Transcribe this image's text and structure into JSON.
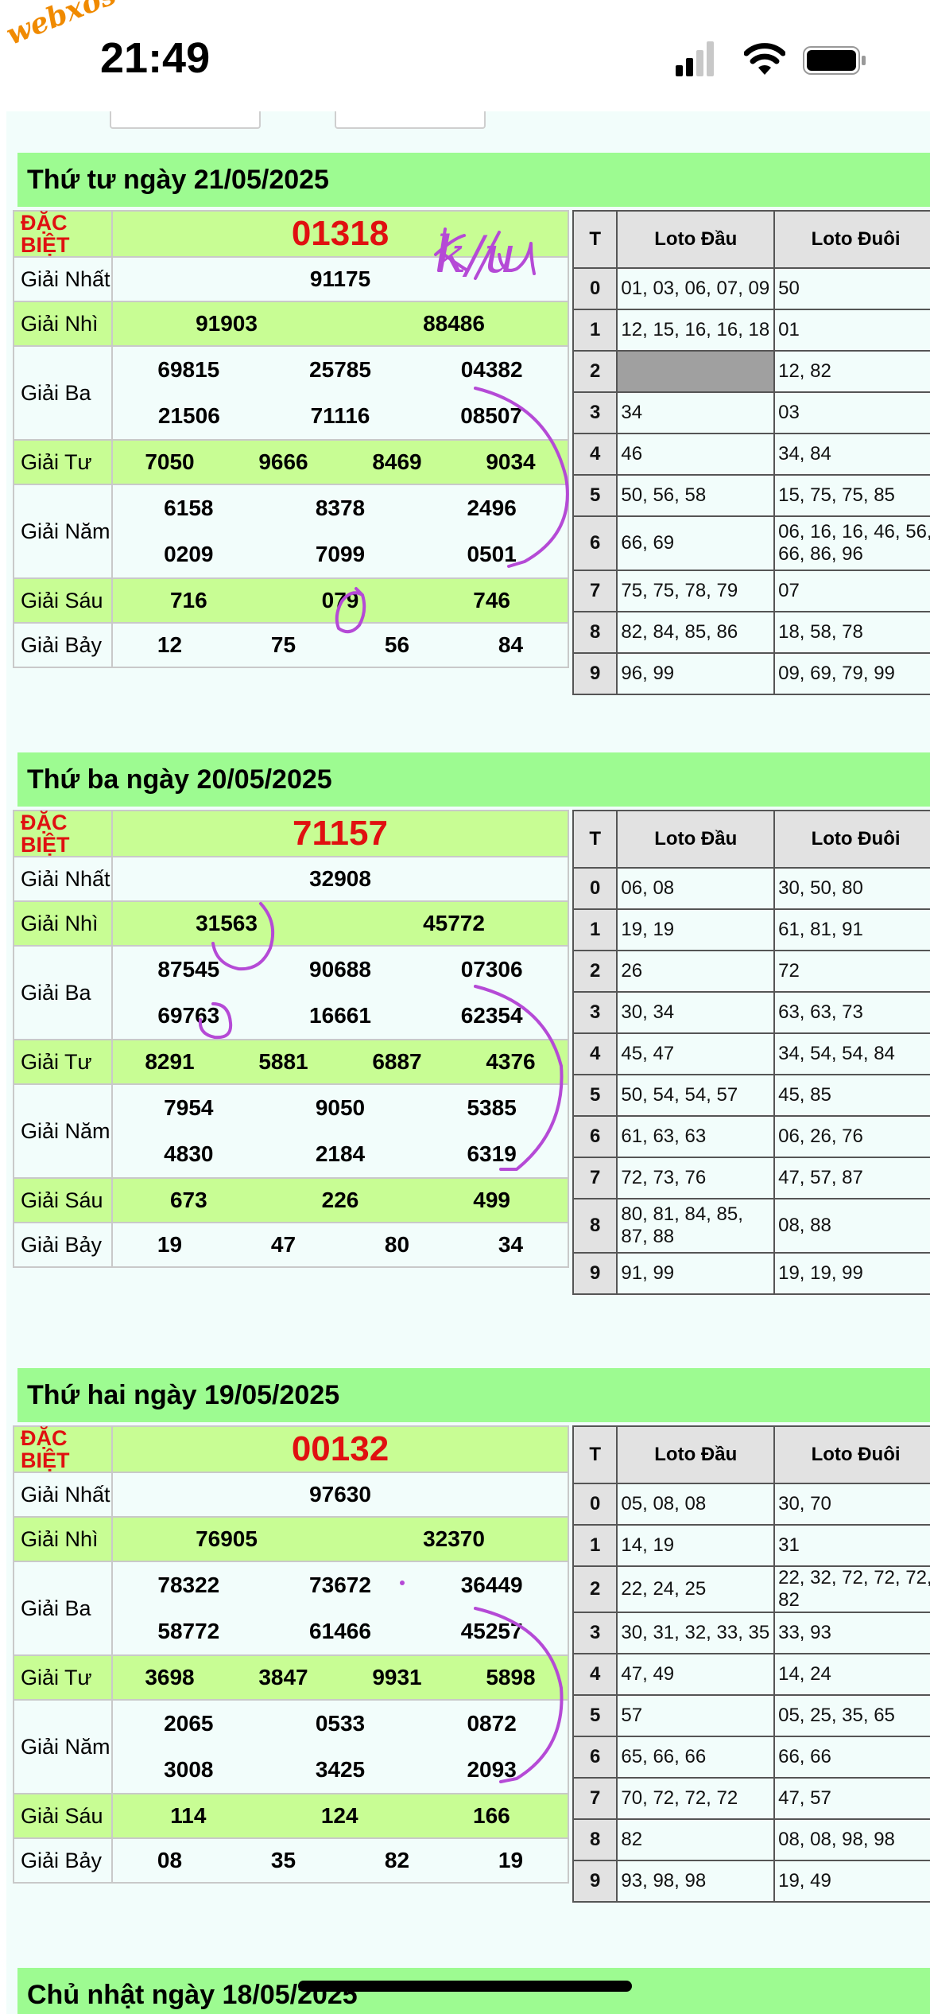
{
  "status": {
    "time": "21:49",
    "watermark": "webxoso.net"
  },
  "labels": {
    "db": "ĐẶC BIỆT",
    "nhat": "Giải Nhất",
    "nhi": "Giải Nhì",
    "ba": "Giải Ba",
    "tu": "Giải Tư",
    "nam": "Giải Năm",
    "sau": "Giải Sáu",
    "bay": "Giải Bảy",
    "t": "T",
    "dau": "Loto Đầu",
    "duoi": "Loto Đuôi"
  },
  "annotation": "k/u",
  "sections": [
    {
      "title": "Thứ tư ngày 21/05/2025",
      "db": "01318",
      "nhat": "91175",
      "nhi": [
        "91903",
        "88486"
      ],
      "ba": [
        [
          "69815",
          "25785",
          "04382"
        ],
        [
          "21506",
          "71116",
          "08507"
        ]
      ],
      "tu": [
        "7050",
        "9666",
        "8469",
        "9034"
      ],
      "nam": [
        [
          "6158",
          "8378",
          "2496"
        ],
        [
          "0209",
          "7099",
          "0501"
        ]
      ],
      "sau": [
        "716",
        "079",
        "746"
      ],
      "bay": [
        "12",
        "75",
        "56",
        "84"
      ],
      "loto": [
        [
          "0",
          "01, 03, 06, 07, 09",
          "50"
        ],
        [
          "1",
          "12, 15, 16, 16, 18",
          "01"
        ],
        [
          "2",
          "",
          "12, 82"
        ],
        [
          "3",
          "34",
          "03"
        ],
        [
          "4",
          "46",
          "34, 84"
        ],
        [
          "5",
          "50, 56, 58",
          "15, 75, 75, 85"
        ],
        [
          "6",
          "66, 69",
          "06, 16, 16, 46, 56, 66, 86, 96"
        ],
        [
          "7",
          "75, 75, 78, 79",
          "07"
        ],
        [
          "8",
          "82, 84, 85, 86",
          "18, 58, 78"
        ],
        [
          "9",
          "96, 99",
          "09, 69, 79, 99"
        ]
      ]
    },
    {
      "title": "Thứ ba ngày 20/05/2025",
      "db": "71157",
      "nhat": "32908",
      "nhi": [
        "31563",
        "45772"
      ],
      "ba": [
        [
          "87545",
          "90688",
          "07306"
        ],
        [
          "69763",
          "16661",
          "62354"
        ]
      ],
      "tu": [
        "8291",
        "5881",
        "6887",
        "4376"
      ],
      "nam": [
        [
          "7954",
          "9050",
          "5385"
        ],
        [
          "4830",
          "2184",
          "6319"
        ]
      ],
      "sau": [
        "673",
        "226",
        "499"
      ],
      "bay": [
        "19",
        "47",
        "80",
        "34"
      ],
      "loto": [
        [
          "0",
          "06, 08",
          "30, 50, 80"
        ],
        [
          "1",
          "19, 19",
          "61, 81, 91"
        ],
        [
          "2",
          "26",
          "72"
        ],
        [
          "3",
          "30, 34",
          "63, 63, 73"
        ],
        [
          "4",
          "45, 47",
          "34, 54, 54, 84"
        ],
        [
          "5",
          "50, 54, 54, 57",
          "45, 85"
        ],
        [
          "6",
          "61, 63, 63",
          "06, 26, 76"
        ],
        [
          "7",
          "72, 73, 76",
          "47, 57, 87"
        ],
        [
          "8",
          "80, 81, 84, 85, 87, 88",
          "08, 88"
        ],
        [
          "9",
          "91, 99",
          "19, 19, 99"
        ]
      ]
    },
    {
      "title": "Thứ hai ngày 19/05/2025",
      "db": "00132",
      "nhat": "97630",
      "nhi": [
        "76905",
        "32370"
      ],
      "ba": [
        [
          "78322",
          "73672",
          "36449"
        ],
        [
          "58772",
          "61466",
          "45257"
        ]
      ],
      "tu": [
        "3698",
        "3847",
        "9931",
        "5898"
      ],
      "nam": [
        [
          "2065",
          "0533",
          "0872"
        ],
        [
          "3008",
          "3425",
          "2093"
        ]
      ],
      "sau": [
        "114",
        "124",
        "166"
      ],
      "bay": [
        "08",
        "35",
        "82",
        "19"
      ],
      "loto": [
        [
          "0",
          "05, 08, 08",
          "30, 70"
        ],
        [
          "1",
          "14, 19",
          "31"
        ],
        [
          "2",
          "22, 24, 25",
          "22, 32, 72, 72, 72, 82"
        ],
        [
          "3",
          "30, 31, 32, 33, 35",
          "33, 93"
        ],
        [
          "4",
          "47, 49",
          "14, 24"
        ],
        [
          "5",
          "57",
          "05, 25, 35, 65"
        ],
        [
          "6",
          "65, 66, 66",
          "66, 66"
        ],
        [
          "7",
          "70, 72, 72, 72",
          "47, 57"
        ],
        [
          "8",
          "82",
          "08, 08, 98, 98"
        ],
        [
          "9",
          "93, 98, 98",
          "19, 49"
        ]
      ]
    },
    {
      "title": "Chủ nhật ngày 18/05/2025"
    }
  ]
}
